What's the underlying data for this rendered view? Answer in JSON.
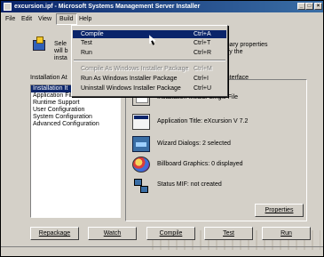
{
  "window": {
    "title": "excursion.ipf - Microsoft Systems Management Server Installer"
  },
  "menubar": {
    "file": "File",
    "edit": "Edit",
    "view": "View",
    "build": "Build",
    "help": "Help"
  },
  "build_menu": {
    "items": [
      {
        "label": "Compile",
        "shortcut": "Ctrl+A"
      },
      {
        "label": "Test",
        "shortcut": "Ctrl+T"
      },
      {
        "label": "Run",
        "shortcut": "Ctrl+R"
      },
      {
        "label": "Compile As Windows Installer Package",
        "shortcut": "Ctrl+M"
      },
      {
        "label": "Run As Windows Installer Package",
        "shortcut": "Ctrl+I"
      },
      {
        "label": "Uninstall Windows Installer Package",
        "shortcut": "Ctrl+U"
      }
    ]
  },
  "intro": {
    "line1": "Sele",
    "line2": "will b",
    "line3": "insta",
    "right1": "mmary properties",
    "right2": "odify the"
  },
  "sections": {
    "left_label": "Installation At",
    "right_label": "n Interface",
    "items": [
      "Installation It",
      "Application Files",
      "Runtime Support",
      "User Configuration",
      "System Configuration",
      "Advanced Configuration"
    ]
  },
  "details": {
    "media": "Installation Media: Single File",
    "title": "Application Title: eXcursion V 7.2",
    "wizard": "Wizard Dialogs: 2 selected",
    "billboard": "Billboard Graphics: 0 displayed",
    "status": "Status MIF: not created"
  },
  "buttons": {
    "properties": "Properties",
    "repackage": "Repackage",
    "watch": "Watch",
    "compile": "Compile",
    "test": "Test",
    "run": "Run"
  }
}
